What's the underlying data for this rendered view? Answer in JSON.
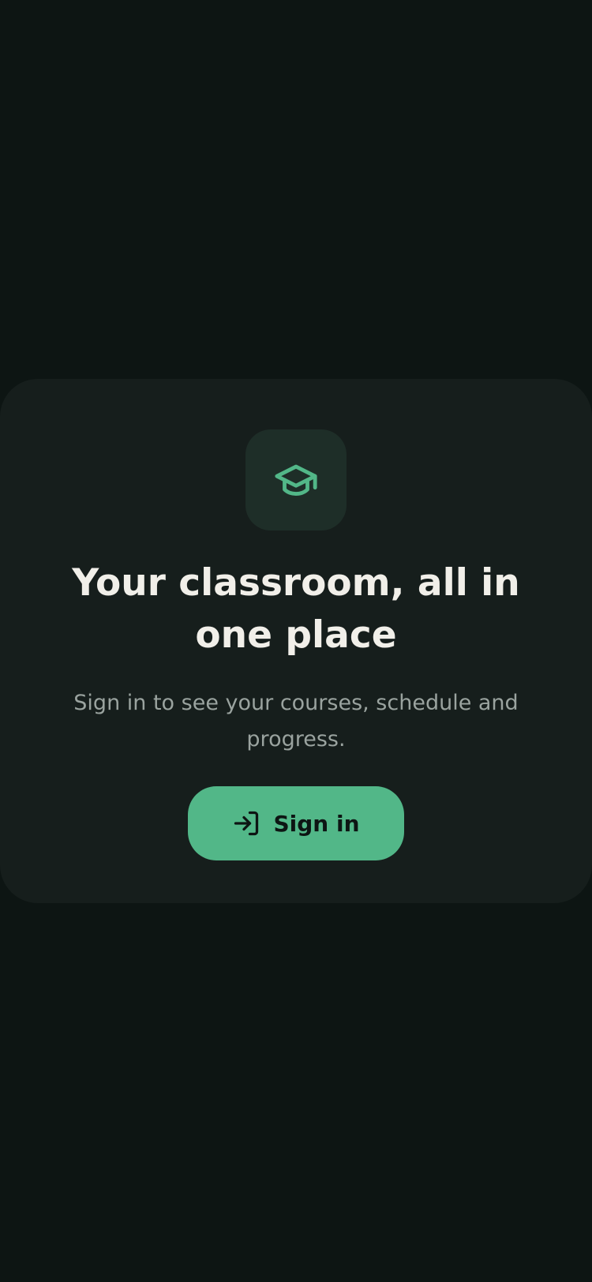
{
  "card": {
    "icon": "graduation-cap-icon",
    "title": "Your classroom, all in one place",
    "subtitle": "Sign in to see your courses, schedule and progress.",
    "button": {
      "icon": "sign-in-icon",
      "label": "Sign in"
    }
  },
  "colors": {
    "background": "#0d1513",
    "card": "#161e1c",
    "accent": "#52b788",
    "title_text": "#f1efe9",
    "subtitle_text": "#9aa39f"
  }
}
